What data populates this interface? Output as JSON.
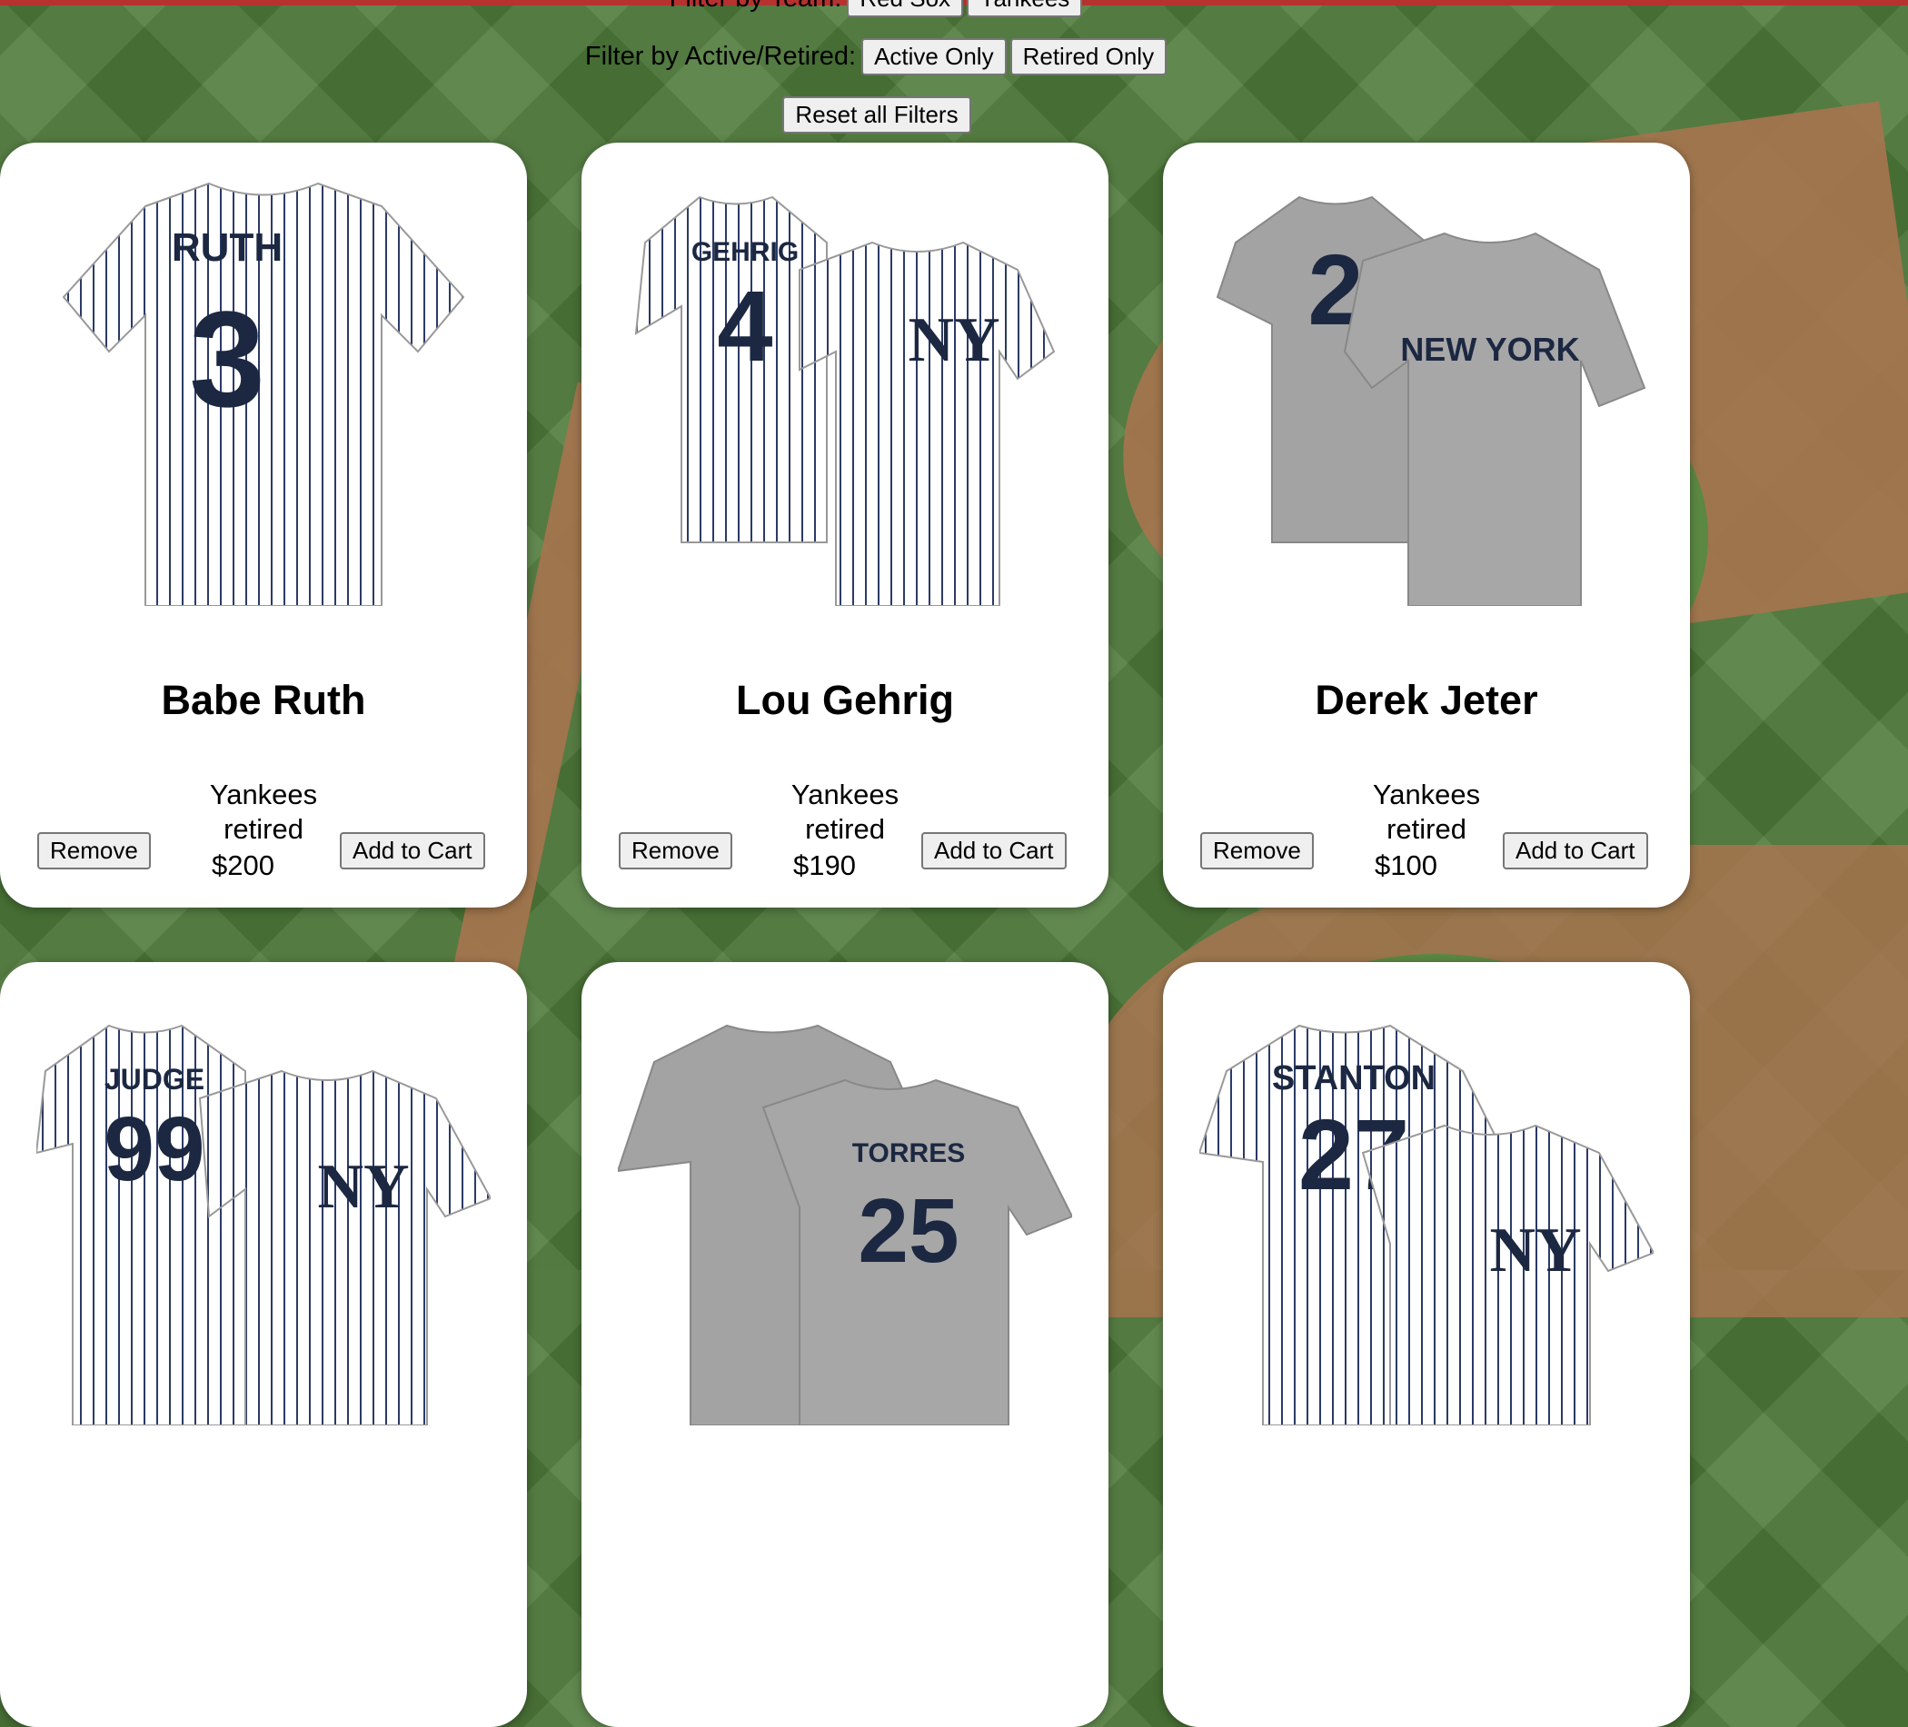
{
  "filters": {
    "team_label": "Filter by Team:",
    "team_options": [
      "Red Sox",
      "Yankees"
    ],
    "active_label": "Filter by Active/Retired:",
    "active_only": "Active Only",
    "retired_only": "Retired Only",
    "reset": "Reset all Filters"
  },
  "buttons": {
    "remove": "Remove",
    "add_to_cart": "Add to Cart"
  },
  "products": [
    {
      "name": "Babe Ruth",
      "team": "Yankees",
      "status": "retired",
      "price": "$200",
      "jersey_name": "RUTH",
      "jersey_number": "3",
      "jersey_style": "pinstripe"
    },
    {
      "name": "Lou Gehrig",
      "team": "Yankees",
      "status": "retired",
      "price": "$190",
      "jersey_name": "GEHRIG",
      "jersey_number": "4",
      "jersey_style": "pinstripe"
    },
    {
      "name": "Derek Jeter",
      "team": "Yankees",
      "status": "retired",
      "price": "$100",
      "jersey_name": "NEW YORK",
      "jersey_number": "2",
      "jersey_style": "gray"
    },
    {
      "jersey_name": "JUDGE",
      "jersey_number": "99",
      "jersey_style": "pinstripe"
    },
    {
      "jersey_name": "TORRES",
      "jersey_number": "25",
      "jersey_style": "gray"
    },
    {
      "jersey_name": "STANTON",
      "jersey_number": "27",
      "jersey_style": "pinstripe"
    }
  ],
  "colors": {
    "navy": "#1c2841",
    "gray_jersey": "#a3a3a3",
    "pinstripe": "#2b3a67"
  }
}
